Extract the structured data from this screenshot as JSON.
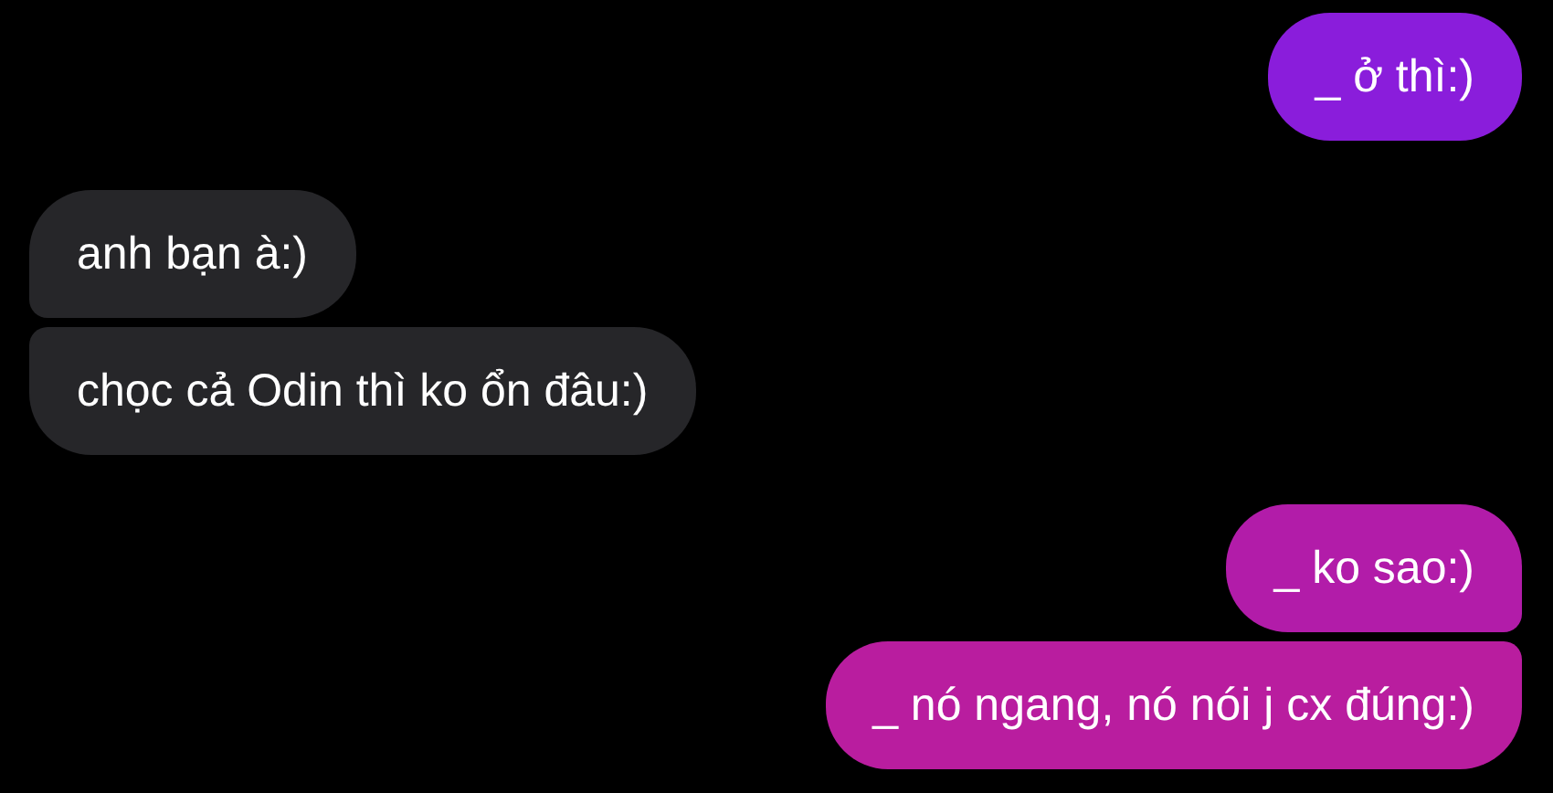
{
  "messages": [
    {
      "kind": "outgoing",
      "text": "_ ở thì:)",
      "color": "#8a1ddb"
    },
    {
      "kind": "incoming",
      "text": "anh bạn à:)",
      "color": "#262629"
    },
    {
      "kind": "incoming",
      "text": "chọc cả Odin thì ko ổn đâu:)",
      "color": "#262629"
    },
    {
      "kind": "outgoing",
      "text": "_ ko sao:)",
      "color": "#b21ca9"
    },
    {
      "kind": "outgoing",
      "text": "_ nó ngang, nó nói j cx đúng:)",
      "color": "#b91d9f"
    }
  ]
}
